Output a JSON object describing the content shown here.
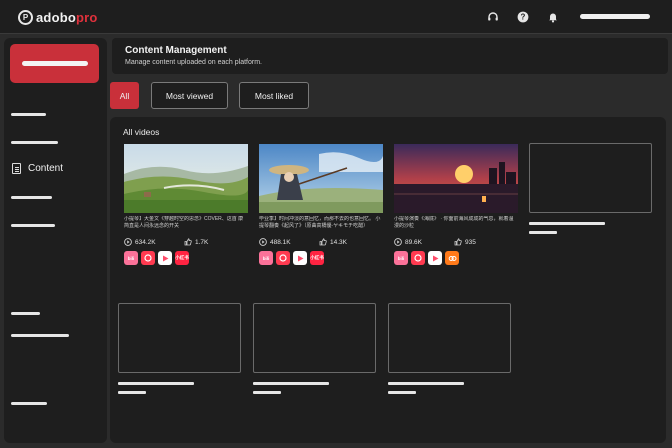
{
  "brand": {
    "mark": "P",
    "name_main": "adobo",
    "name_accent": "pro"
  },
  "header": {
    "title": "Content Management",
    "subtitle": "Manage content uploaded on each platform."
  },
  "sidebar": {
    "active_item": "Content"
  },
  "filters": [
    "All",
    "Most viewed",
    "Most liked"
  ],
  "section_title": "All videos",
  "colors": {
    "accent": "#c9303a",
    "background": "#2b2b2b",
    "panel": "#1e1e1e"
  },
  "videos": [
    {
      "caption": "小提琴】大金文《穿越时空的思念》COVER、这首 康简直是人间永远念的开关",
      "views": "634.2K",
      "likes": "1.7K",
      "platforms": [
        "bilibili",
        "kuaishou",
        "youtube-music",
        "xiaohongshu"
      ]
    },
    {
      "caption": "毕业季】时间冲淡的意回忆，而那不去的也意回忆。 小提琴翻奏《起风了》（原曲高橋優·ヤキモチ吃醋）",
      "views": "488.1K",
      "likes": "14.3K",
      "platforms": [
        "bilibili",
        "kuaishou",
        "youtube-music",
        "xiaohongshu"
      ]
    },
    {
      "caption": "小提琴演奏《海底》 · 你面前海风成成的气息，就着温漫的沙粒",
      "views": "89.6K",
      "likes": "935",
      "platforms": [
        "bilibili",
        "kuaishou",
        "youtube-music",
        "weibo"
      ]
    }
  ],
  "platform_labels": {
    "bilibili": "bili",
    "xiaohongshu": "小红书"
  }
}
